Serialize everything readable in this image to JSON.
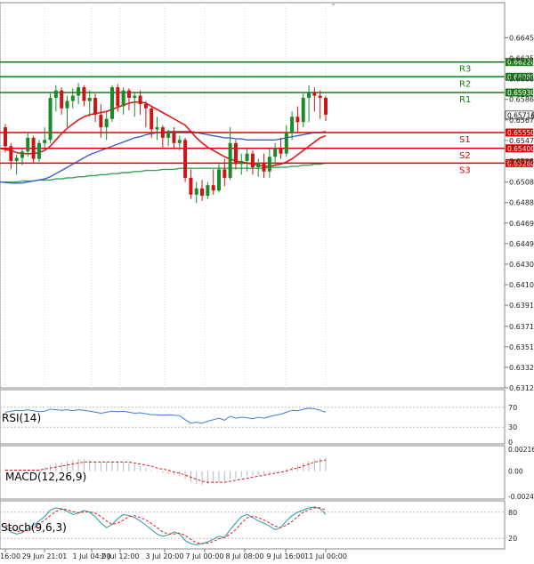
{
  "chart_data": [
    {
      "type": "candlestick",
      "ylim": [
        0.63125,
        0.6664
      ],
      "price_ticks": [
        "0.66450",
        "0.66255",
        "0.66060",
        "0.65865",
        "0.65670",
        "0.65475",
        "0.65280",
        "0.65080",
        "0.64885",
        "0.64690",
        "0.64495",
        "0.64300",
        "0.64105",
        "0.63910",
        "0.63710",
        "0.63515",
        "0.63320",
        "0.63125"
      ],
      "x_labels": [
        "16:00",
        "29 Jun 21:01",
        "1 Jul 04:00",
        "2 Jul 12:00",
        "3 Jul 20:00",
        "7 Jul 00:00",
        "8 Jul 08:00",
        "9 Jul 16:00",
        "11 Jul 00:00"
      ],
      "current_price": "0.65716",
      "levels": [
        {
          "name": "R3",
          "value": "0.66220",
          "color": "#1a7a1a"
        },
        {
          "name": "R2",
          "value": "0.66080",
          "color": "#1a7a1a"
        },
        {
          "name": "R1",
          "value": "0.65930",
          "color": "#1a7a1a"
        },
        {
          "name": "S1",
          "value": "0.65550",
          "color": "#dd0000"
        },
        {
          "name": "S2",
          "value": "0.65400",
          "color": "#dd0000"
        },
        {
          "name": "S3",
          "value": "0.65260",
          "color": "#dd0000"
        }
      ],
      "candles": [
        [
          0.656,
          0.6563,
          0.6536,
          0.6542
        ],
        [
          0.6542,
          0.6545,
          0.652,
          0.6528
        ],
        [
          0.6528,
          0.6534,
          0.6515,
          0.6531
        ],
        [
          0.6531,
          0.654,
          0.6524,
          0.6537
        ],
        [
          0.6537,
          0.6555,
          0.6532,
          0.655
        ],
        [
          0.655,
          0.6552,
          0.6526,
          0.653
        ],
        [
          0.653,
          0.6548,
          0.6527,
          0.6545
        ],
        [
          0.6545,
          0.656,
          0.6538,
          0.6548
        ],
        [
          0.6548,
          0.6592,
          0.6545,
          0.6588
        ],
        [
          0.6588,
          0.66,
          0.6575,
          0.6595
        ],
        [
          0.6595,
          0.6598,
          0.6572,
          0.6578
        ],
        [
          0.6578,
          0.659,
          0.656,
          0.6585
        ],
        [
          0.6585,
          0.6597,
          0.6578,
          0.659
        ],
        [
          0.659,
          0.6602,
          0.6582,
          0.6598
        ],
        [
          0.6598,
          0.66,
          0.658,
          0.6585
        ],
        [
          0.6585,
          0.6595,
          0.657,
          0.6588
        ],
        [
          0.6588,
          0.6592,
          0.6565,
          0.6572
        ],
        [
          0.6572,
          0.6582,
          0.655,
          0.656
        ],
        [
          0.656,
          0.6575,
          0.6548,
          0.6568
        ],
        [
          0.6568,
          0.66,
          0.6565,
          0.6598
        ],
        [
          0.6598,
          0.6601,
          0.6575,
          0.658
        ],
        [
          0.658,
          0.6598,
          0.6572,
          0.6595
        ],
        [
          0.6595,
          0.6597,
          0.6576,
          0.6588
        ],
        [
          0.6588,
          0.6593,
          0.657,
          0.659
        ],
        [
          0.659,
          0.6595,
          0.6572,
          0.6582
        ],
        [
          0.6582,
          0.6585,
          0.656,
          0.6578
        ],
        [
          0.6578,
          0.658,
          0.655,
          0.6558
        ],
        [
          0.6558,
          0.657,
          0.6548,
          0.656
        ],
        [
          0.656,
          0.6562,
          0.654,
          0.655
        ],
        [
          0.655,
          0.6558,
          0.6542,
          0.6555
        ],
        [
          0.6555,
          0.656,
          0.654,
          0.6545
        ],
        [
          0.6545,
          0.6552,
          0.6538,
          0.6548
        ],
        [
          0.6548,
          0.655,
          0.6508,
          0.6512
        ],
        [
          0.6512,
          0.652,
          0.6492,
          0.6496
        ],
        [
          0.6496,
          0.6508,
          0.6488,
          0.6502
        ],
        [
          0.6502,
          0.651,
          0.649,
          0.6495
        ],
        [
          0.6495,
          0.6508,
          0.6492,
          0.6505
        ],
        [
          0.6505,
          0.652,
          0.6496,
          0.65
        ],
        [
          0.65,
          0.6525,
          0.6498,
          0.652
        ],
        [
          0.652,
          0.653,
          0.6504,
          0.6512
        ],
        [
          0.6512,
          0.656,
          0.651,
          0.6545
        ],
        [
          0.6545,
          0.6548,
          0.652,
          0.6525
        ],
        [
          0.6525,
          0.6535,
          0.6515,
          0.6528
        ],
        [
          0.6528,
          0.654,
          0.6518,
          0.6535
        ],
        [
          0.6535,
          0.6538,
          0.6515,
          0.6522
        ],
        [
          0.6522,
          0.653,
          0.6513,
          0.6526
        ],
        [
          0.6526,
          0.6535,
          0.6512,
          0.6518
        ],
        [
          0.6518,
          0.654,
          0.6512,
          0.6532
        ],
        [
          0.6532,
          0.6545,
          0.6525,
          0.654
        ],
        [
          0.654,
          0.655,
          0.653,
          0.6535
        ],
        [
          0.6535,
          0.6562,
          0.6532,
          0.6555
        ],
        [
          0.6555,
          0.6575,
          0.6548,
          0.657
        ],
        [
          0.657,
          0.658,
          0.6555,
          0.6565
        ],
        [
          0.6565,
          0.6592,
          0.656,
          0.6588
        ],
        [
          0.6588,
          0.66,
          0.6565,
          0.6593
        ],
        [
          0.6593,
          0.6598,
          0.6575,
          0.659
        ],
        [
          0.659,
          0.6595,
          0.6568,
          0.6588
        ],
        [
          0.6588,
          0.659,
          0.6566,
          0.6572
        ]
      ],
      "ma_red": [
        0.654,
        0.6538,
        0.6536,
        0.6535,
        0.6535,
        0.6535,
        0.6536,
        0.6538,
        0.6542,
        0.6548,
        0.6554,
        0.6559,
        0.6563,
        0.6567,
        0.657,
        0.6572,
        0.6573,
        0.6574,
        0.6575,
        0.6577,
        0.6579,
        0.6581,
        0.6583,
        0.6584,
        0.6584,
        0.6583,
        0.658,
        0.6577,
        0.6574,
        0.6571,
        0.6568,
        0.6565,
        0.6562,
        0.6556,
        0.655,
        0.6545,
        0.6541,
        0.6538,
        0.6535,
        0.6532,
        0.653,
        0.6528,
        0.6527,
        0.6526,
        0.6525,
        0.6524,
        0.6523,
        0.6523,
        0.6524,
        0.6525,
        0.6527,
        0.653,
        0.6534,
        0.6538,
        0.6542,
        0.6546,
        0.655,
        0.6552
      ],
      "ma_blue": [
        0.6508,
        0.6507,
        0.6507,
        0.6507,
        0.6508,
        0.6509,
        0.651,
        0.6511,
        0.6513,
        0.6516,
        0.6519,
        0.6522,
        0.6525,
        0.6528,
        0.6531,
        0.6534,
        0.6536,
        0.6538,
        0.654,
        0.6542,
        0.6544,
        0.6546,
        0.6548,
        0.655,
        0.6551,
        0.6553,
        0.6554,
        0.6555,
        0.6555,
        0.6556,
        0.6556,
        0.6556,
        0.6556,
        0.6556,
        0.6555,
        0.6554,
        0.6553,
        0.6552,
        0.6551,
        0.655,
        0.655,
        0.6549,
        0.6549,
        0.6548,
        0.6548,
        0.6548,
        0.6548,
        0.6548,
        0.6548,
        0.6549,
        0.655,
        0.6551,
        0.6552,
        0.6553,
        0.6554,
        0.6555,
        0.6555,
        0.6556
      ],
      "ma_green": [
        0.6508,
        0.6508,
        0.6508,
        0.6509,
        0.6509,
        0.6509,
        0.651,
        0.651,
        0.651,
        0.6511,
        0.6511,
        0.6512,
        0.6512,
        0.6513,
        0.6513,
        0.6514,
        0.6514,
        0.6515,
        0.6515,
        0.6516,
        0.6516,
        0.6517,
        0.6517,
        0.6518,
        0.6518,
        0.6519,
        0.6519,
        0.6519,
        0.652,
        0.652,
        0.652,
        0.6521,
        0.6521,
        0.6521,
        0.6521,
        0.6521,
        0.6521,
        0.6521,
        0.6521,
        0.6521,
        0.6521,
        0.6521,
        0.6521,
        0.6521,
        0.6521,
        0.6521,
        0.6521,
        0.6522,
        0.6522,
        0.6522,
        0.6522,
        0.6523,
        0.6523,
        0.6524,
        0.6524,
        0.6525,
        0.6525,
        0.6526
      ]
    },
    {
      "type": "line",
      "label": "RSI(14)",
      "ticks": [
        "70",
        "30",
        "0"
      ],
      "ylim": [
        0,
        100
      ],
      "values": [
        60,
        62,
        64,
        63,
        65,
        63,
        61,
        62,
        66,
        65,
        64,
        65,
        63,
        65,
        64,
        62,
        60,
        58,
        60,
        62,
        61,
        62,
        60,
        58,
        59,
        57,
        55,
        55,
        54,
        55,
        54,
        53,
        45,
        38,
        40,
        38,
        42,
        45,
        48,
        44,
        52,
        48,
        50,
        49,
        47,
        50,
        48,
        51,
        54,
        56,
        60,
        64,
        63,
        66,
        68,
        67,
        64,
        60
      ]
    },
    {
      "type": "bar",
      "label": "MACD(12,26,9)",
      "ticks": [
        "0.002164",
        "0.00",
        "-0.002497"
      ],
      "ylim": [
        -0.002497,
        0.002164
      ],
      "histogram": [
        0.0002,
        0.0001,
        0.0,
        -0.0001,
        0.0,
        0.0001,
        0.0002,
        0.0004,
        0.0006,
        0.0008,
        0.0009,
        0.001,
        0.0011,
        0.0012,
        0.0012,
        0.0011,
        0.001,
        0.0009,
        0.0009,
        0.001,
        0.001,
        0.0009,
        0.0008,
        0.0007,
        0.0005,
        0.0003,
        0.0001,
        -0.0001,
        -0.0002,
        -0.0003,
        -0.0004,
        -0.0005,
        -0.0008,
        -0.0011,
        -0.0013,
        -0.0014,
        -0.0013,
        -0.0012,
        -0.0011,
        -0.001,
        -0.0008,
        -0.0007,
        -0.0006,
        -0.0005,
        -0.0004,
        -0.0004,
        -0.0003,
        -0.0002,
        -0.0001,
        0.0,
        0.0002,
        0.0004,
        0.0006,
        0.0008,
        0.001,
        0.0012,
        0.0013,
        0.0013
      ],
      "signal": [
        0.0001,
        0.0001,
        0.0001,
        0.0001,
        0.0001,
        0.0001,
        0.0001,
        0.0002,
        0.0003,
        0.0004,
        0.0005,
        0.0006,
        0.0007,
        0.0008,
        0.0009,
        0.0009,
        0.0009,
        0.0009,
        0.0009,
        0.0009,
        0.0009,
        0.0009,
        0.0009,
        0.0008,
        0.0007,
        0.0006,
        0.0005,
        0.0003,
        0.0002,
        0.0001,
        -0.0001,
        -0.0002,
        -0.0004,
        -0.0006,
        -0.0008,
        -0.001,
        -0.0011,
        -0.0011,
        -0.0011,
        -0.0011,
        -0.001,
        -0.0009,
        -0.0008,
        -0.0007,
        -0.0006,
        -0.0005,
        -0.0004,
        -0.0003,
        -0.0002,
        -0.0001,
        0.0,
        0.0002,
        0.0003,
        0.0005,
        0.0007,
        0.0009,
        0.001,
        0.0011
      ]
    },
    {
      "type": "line",
      "label": "Stoch(9,6,3)",
      "ticks": [
        "80",
        "20"
      ],
      "ylim": [
        0,
        100
      ],
      "main": [
        45,
        35,
        30,
        33,
        42,
        50,
        60,
        70,
        85,
        90,
        88,
        82,
        75,
        78,
        84,
        80,
        70,
        55,
        45,
        52,
        65,
        75,
        72,
        68,
        60,
        50,
        40,
        30,
        25,
        28,
        35,
        30,
        15,
        8,
        5,
        8,
        12,
        18,
        25,
        22,
        40,
        55,
        70,
        75,
        68,
        60,
        55,
        48,
        40,
        45,
        60,
        72,
        80,
        85,
        90,
        92,
        88,
        75
      ],
      "signal": [
        50,
        43,
        37,
        35,
        38,
        44,
        52,
        62,
        72,
        82,
        87,
        86,
        81,
        79,
        80,
        81,
        78,
        70,
        60,
        52,
        55,
        62,
        70,
        72,
        68,
        62,
        54,
        45,
        35,
        30,
        30,
        32,
        27,
        18,
        10,
        8,
        9,
        13,
        19,
        22,
        30,
        40,
        55,
        67,
        71,
        68,
        62,
        55,
        48,
        45,
        50,
        59,
        70,
        80,
        86,
        90,
        90,
        85
      ]
    }
  ]
}
